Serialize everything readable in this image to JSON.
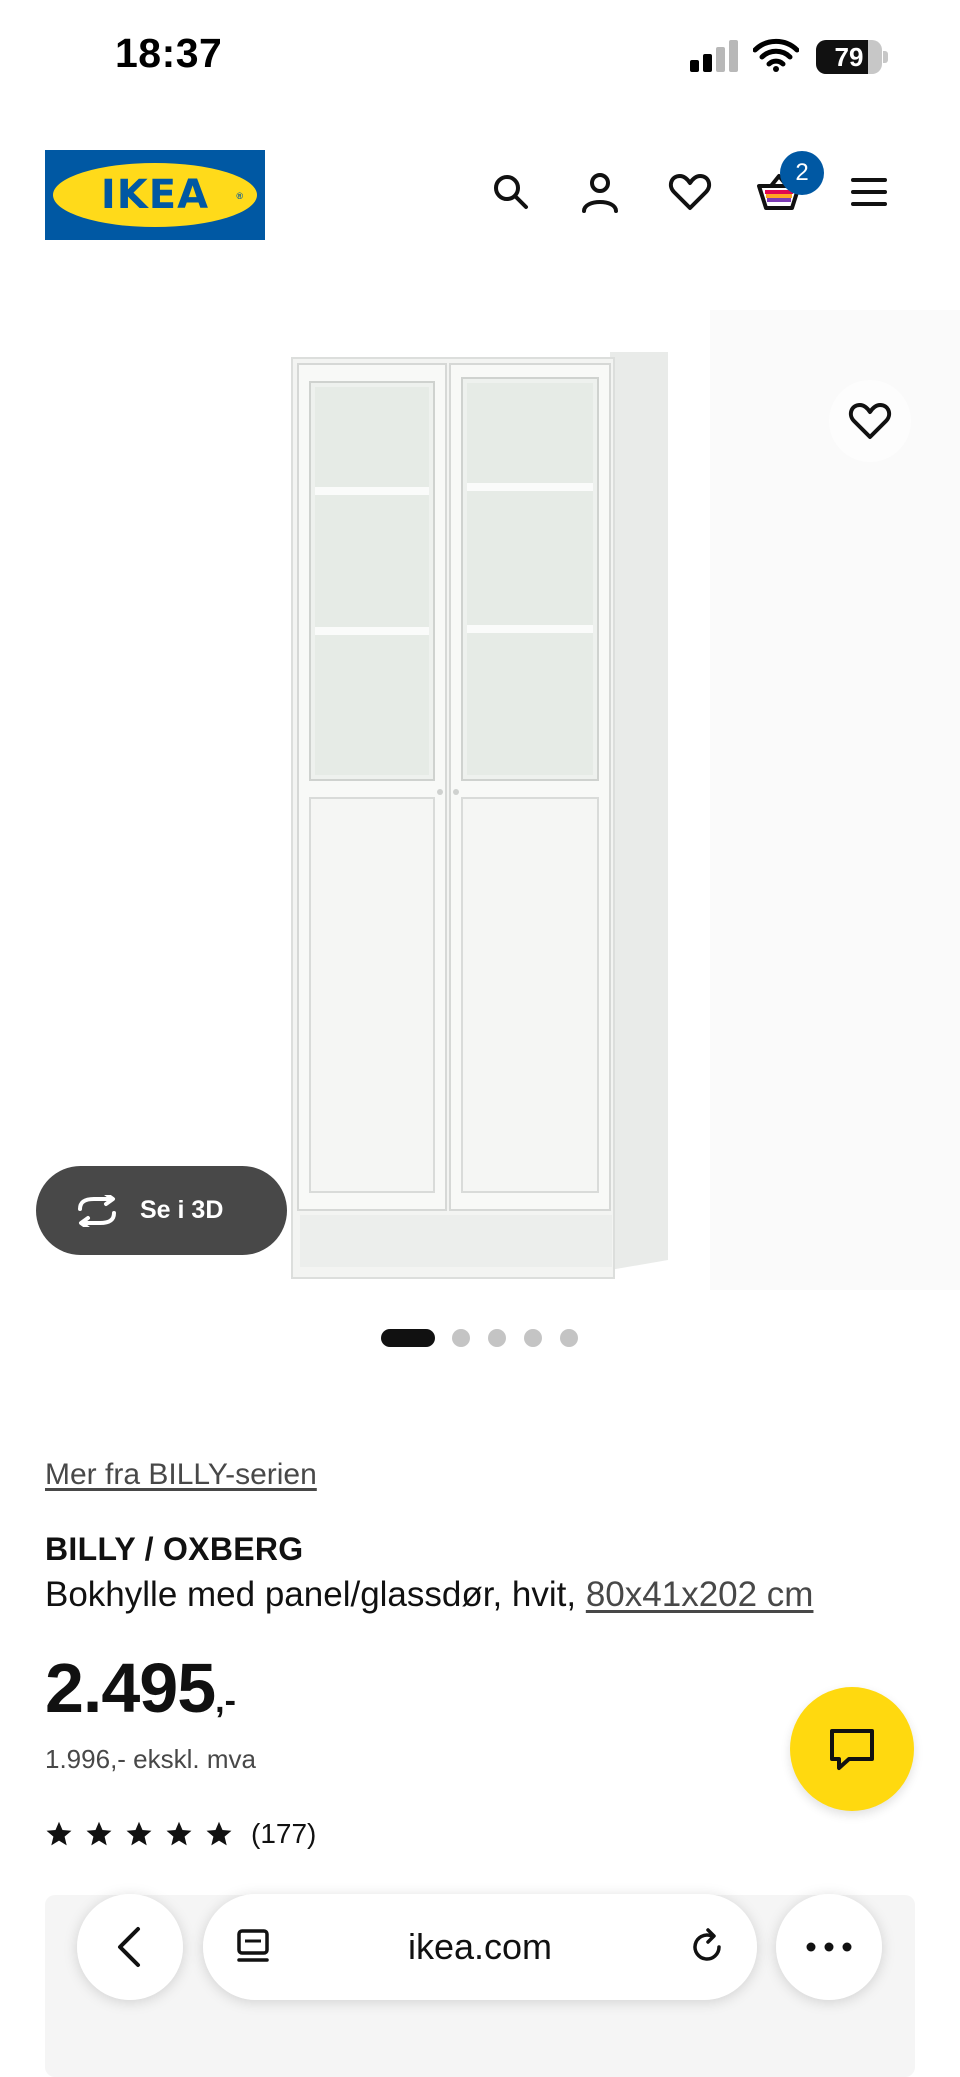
{
  "status_bar": {
    "time": "18:37",
    "battery_level": "79"
  },
  "header": {
    "logo_text": "IKEA",
    "cart_count": "2",
    "icons": [
      "search-icon",
      "account-icon",
      "favorites-icon",
      "cart-icon",
      "menu-icon"
    ]
  },
  "gallery": {
    "view_3d_label": "Se i 3D",
    "image_count": 5,
    "active_image": 1
  },
  "product": {
    "series_link": "Mer fra BILLY-serien",
    "name": "BILLY / OXBERG",
    "description": "Bokhylle med panel/glassdør, hvit, ",
    "dimensions": "80x41x202 cm",
    "price": "2.495",
    "price_suffix": ",-",
    "price_ex_vat": "1.996,- ekskl. mva",
    "rating_stars": 5,
    "rating_count": "(177)"
  },
  "browser": {
    "url": "ikea.com"
  },
  "colors": {
    "ikea_blue": "#0058a3",
    "ikea_yellow": "#ffda1a",
    "chat_yellow": "#ffd90f",
    "pill_dark": "#484848"
  }
}
